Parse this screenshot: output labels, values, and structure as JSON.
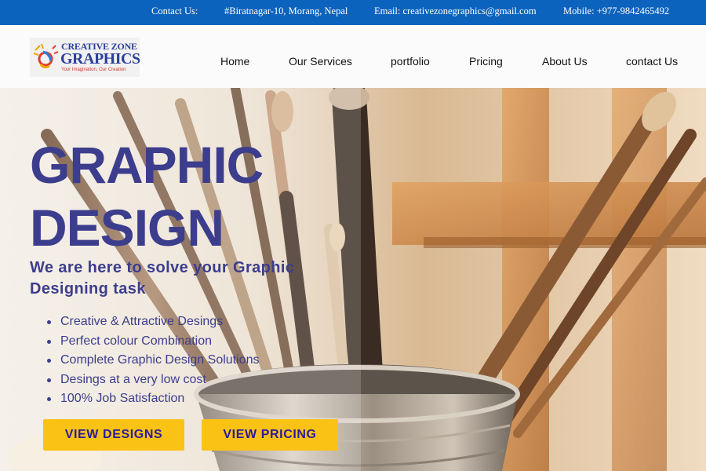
{
  "topbar": {
    "contact_label": "Contact Us:",
    "address": "#Biratnagar-10, Morang, Nepal",
    "email": "Email: creativezonegraphics@gmail.com",
    "mobile": "Mobile: +977-9842465492"
  },
  "logo": {
    "line1": "CREATIVE ZONE",
    "line2": "GRAPHICS",
    "tagline": "Your Imagination, Our Creation"
  },
  "nav": {
    "items": [
      {
        "label": "Home"
      },
      {
        "label": "Our Services"
      },
      {
        "label": "portfolio"
      },
      {
        "label": "Pricing"
      },
      {
        "label": "About Us"
      },
      {
        "label": "contact Us"
      }
    ]
  },
  "hero": {
    "title_line1": "GRAPHIC",
    "title_line2": "DESIGN",
    "subtitle": "We are here to solve your Graphic Designing task",
    "features": [
      "Creative & Attractive Desings",
      "Perfect colour Combination",
      "Complete Graphic Design Solutions",
      "Desings at a very low cost",
      "100% Job Satisfaction"
    ],
    "buttons": {
      "designs": "VIEW DESIGNS",
      "pricing": "VIEW PRICING"
    }
  },
  "colors": {
    "topbar_bg": "#0c63bd",
    "accent_text": "#3c3d8c",
    "button_bg": "#fbc216",
    "button_text": "#2a1a9c"
  }
}
